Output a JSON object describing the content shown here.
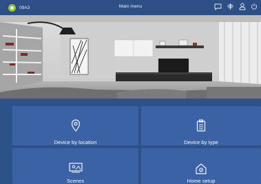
{
  "statusbar": {
    "user_code": "09A3",
    "title": "Main menu",
    "icons": [
      "chat-icon",
      "network-icon",
      "user-icon",
      "power-icon"
    ]
  },
  "hero": {
    "image": "living-room-photo"
  },
  "tiles": [
    {
      "label": "Device by location",
      "icon": "location-pin-icon"
    },
    {
      "label": "Device by type",
      "icon": "clipboard-icon"
    },
    {
      "label": "Scenes",
      "icon": "scenes-icon"
    },
    {
      "label": "Home setup",
      "icon": "home-gear-icon"
    }
  ],
  "colors": {
    "header": "#2d4f85",
    "tile": "#3b62a5",
    "background": "#2c4f86",
    "status_dot": "#92c33a"
  }
}
